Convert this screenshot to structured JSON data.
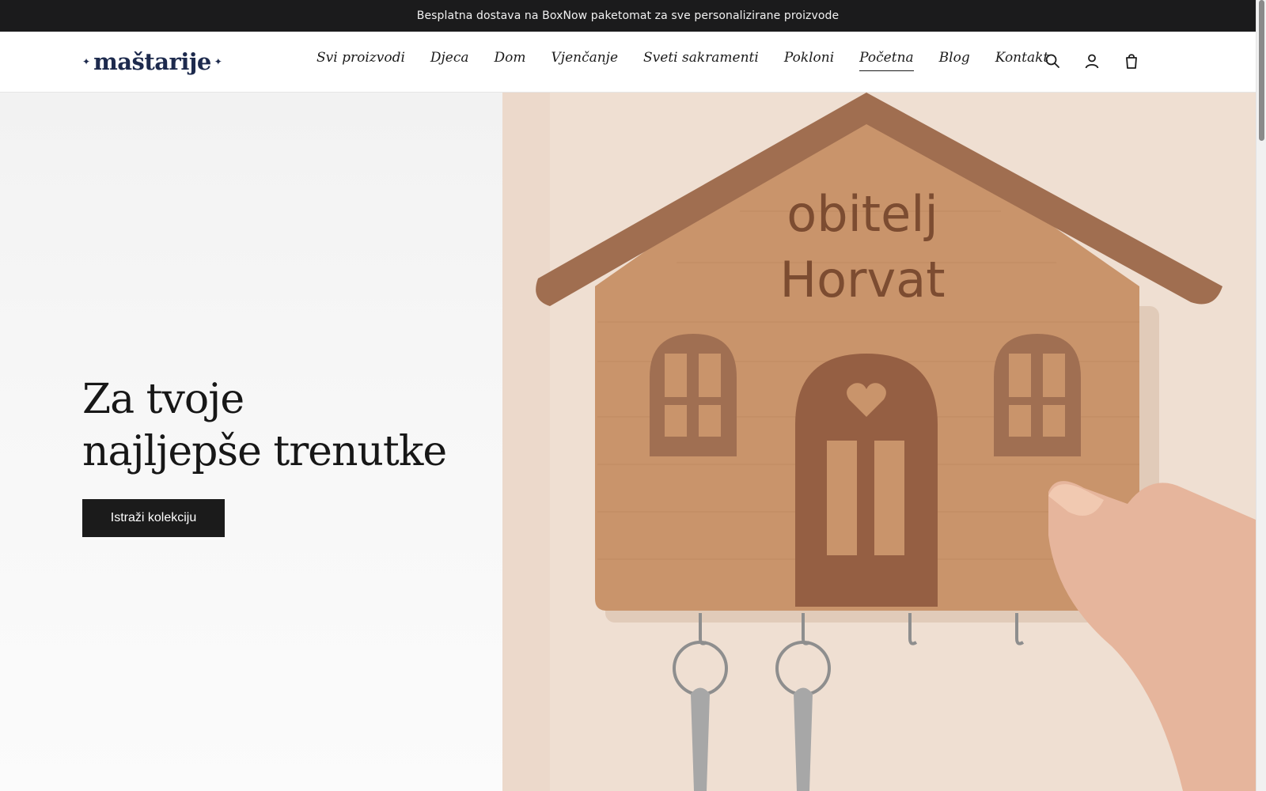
{
  "announcement": {
    "text": "Besplatna dostava na BoxNow paketomat za sve personalizirane proizvode"
  },
  "header": {
    "logo_text": "mašt arije",
    "logo_star": "✦",
    "nav": [
      {
        "label": "Svi proizvodi",
        "active": false
      },
      {
        "label": "Djeca",
        "active": false
      },
      {
        "label": "Dom",
        "active": false
      },
      {
        "label": "Vjenčanje",
        "active": false
      },
      {
        "label": "Sveti sakramenti",
        "active": false
      },
      {
        "label": "Pokloni",
        "active": false
      },
      {
        "label": "Početna",
        "active": true
      },
      {
        "label": "Blog",
        "active": false
      },
      {
        "label": "Kontakt",
        "active": false
      }
    ],
    "icons": [
      "search-icon",
      "account-icon",
      "cart-icon"
    ]
  },
  "hero": {
    "title_line1": "Za tvoje",
    "title_line2": "najljepše trenutke",
    "cta_label": "Istraži kolekciju",
    "photo": {
      "engraving_line1": "obitelj",
      "engraving_line2": "Horvat"
    }
  },
  "colors": {
    "announcement_bg": "#1b1b1c",
    "brand": "#1d2a4d",
    "cta_bg": "#1b1b1b",
    "wood": "#c8936a",
    "copper": "#9e6a4d"
  }
}
